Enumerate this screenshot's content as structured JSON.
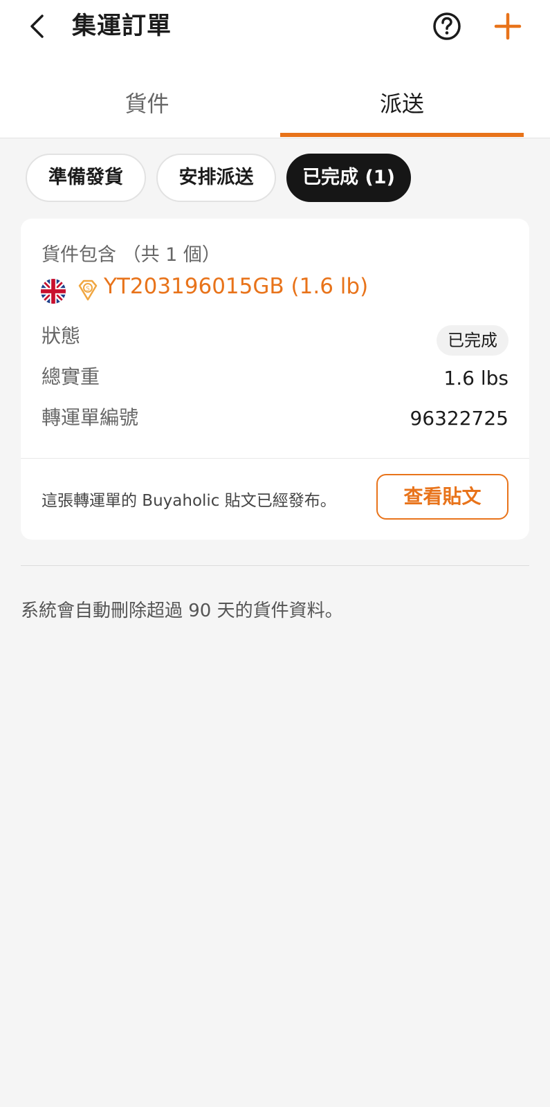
{
  "header": {
    "title": "集運訂單",
    "icons": {
      "back": "chevron-left-icon",
      "help": "question-circle-icon",
      "add": "plus-icon"
    }
  },
  "tabs": [
    {
      "label": "貨件",
      "active": false
    },
    {
      "label": "派送",
      "active": true
    }
  ],
  "filters": [
    {
      "label": "準備發貨",
      "selected": false
    },
    {
      "label": "安排派送",
      "selected": false
    },
    {
      "label": "已完成 (1)",
      "selected": true
    }
  ],
  "order_card": {
    "goods_title": "貨件包含 （共 1 個）",
    "flag_icon": "uk-flag-icon",
    "badge_icon": "s-diamond-badge-icon",
    "tracking": "YT203196015GB (1.6 lb)",
    "rows": [
      {
        "label": "狀態",
        "value": "已完成"
      },
      {
        "label": "總實重",
        "value": "1.6 lbs"
      },
      {
        "label": "轉運單編號",
        "value": "96322725"
      }
    ],
    "notice": "這張轉運單的 Buyaholic 貼文已經發布。",
    "view_post_button": "查看貼文"
  },
  "footer_note": "系統會自動刪除超過 90 天的貨件資料。",
  "colors": {
    "accent": "#e8731a",
    "dark_chip": "#161616",
    "background": "#f5f5f5"
  }
}
